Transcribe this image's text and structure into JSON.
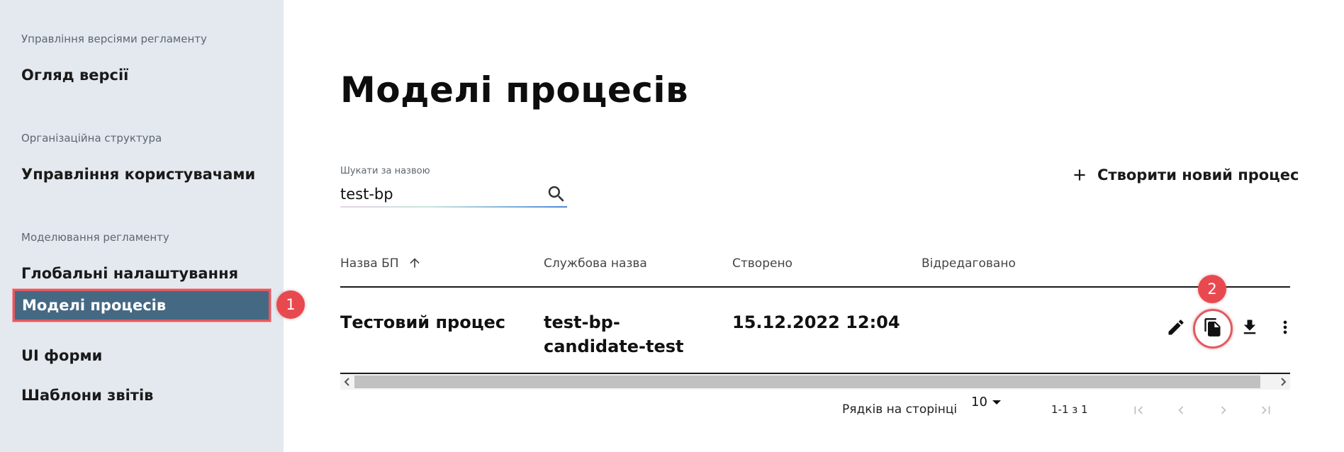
{
  "sidebar": {
    "sections": [
      {
        "heading": "Управління версіями регламенту",
        "items": [
          "Огляд версії"
        ]
      },
      {
        "heading": "Організаційна структура",
        "items": [
          "Управління користувачами"
        ]
      },
      {
        "heading": "Моделювання регламенту",
        "items": [
          "Глобальні налаштування",
          "Моделі процесів",
          "UI форми",
          "Шаблони звітів"
        ]
      }
    ],
    "active_item": "Моделі процесів"
  },
  "markers": [
    "1",
    "2"
  ],
  "main": {
    "title": "Моделі процесів",
    "search": {
      "label": "Шукати за назвою",
      "value": "test-bp"
    },
    "create_button": "Створити новий процес",
    "table": {
      "columns": [
        "Назва БП",
        "Службова назва",
        "Створено",
        "Відредаговано"
      ],
      "sort_column": "Назва БП",
      "sort_direction": "asc",
      "rows": [
        {
          "name": "Тестовий процес",
          "service_name_line1": "test-bp-",
          "service_name_line2": "candidate-test",
          "created": "15.12.2022 12:04",
          "edited": ""
        }
      ],
      "row_actions": [
        "edit-icon",
        "copy-icon",
        "download-icon",
        "more-vert-icon"
      ]
    },
    "pagination": {
      "rows_per_page_label": "Рядків на сторінці",
      "rows_per_page": "10",
      "range": "1-1 з 1",
      "buttons": [
        "first-page-icon",
        "prev-page-icon",
        "next-page-icon",
        "last-page-icon"
      ]
    }
  },
  "colors": {
    "sidebar_bg": "#e4e9ef",
    "active_bg": "#456983",
    "marker": "#e8494f",
    "text": "#1a1a1a"
  }
}
